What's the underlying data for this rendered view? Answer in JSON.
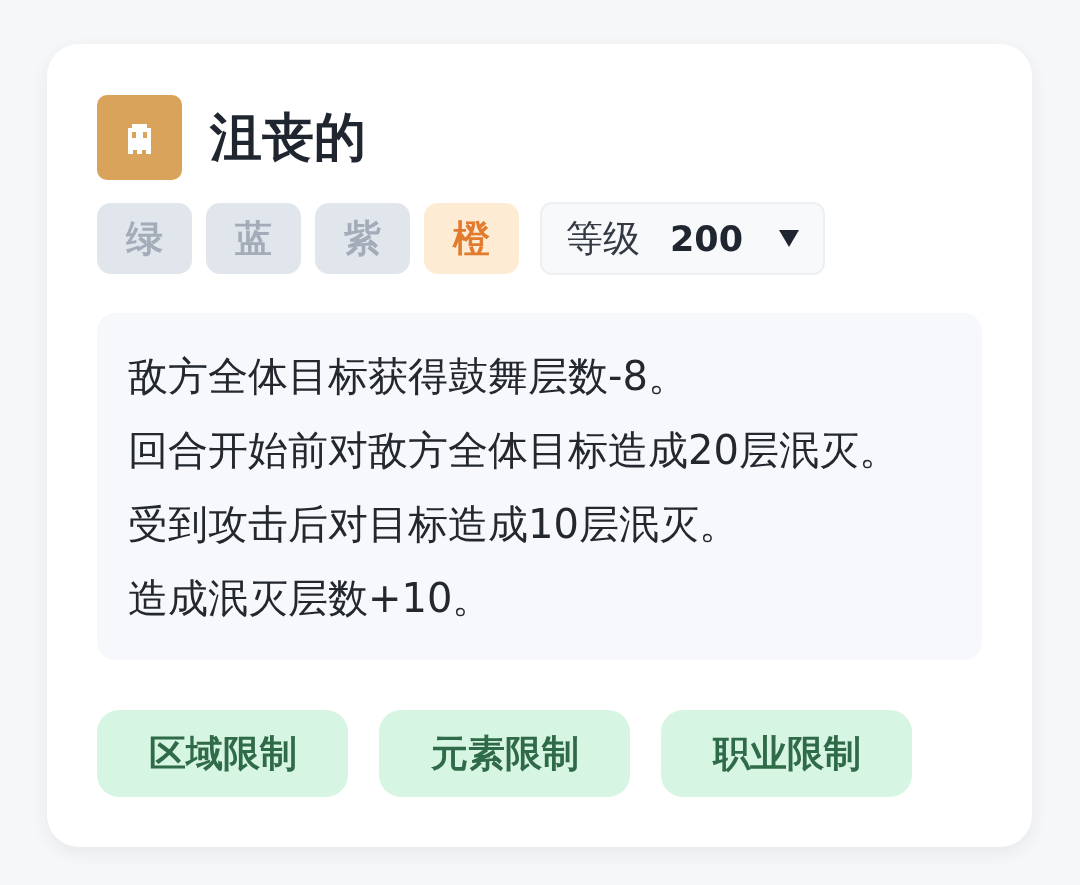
{
  "card": {
    "title": "沮丧的",
    "rarities": [
      {
        "label": "绿",
        "selected": false
      },
      {
        "label": "蓝",
        "selected": false
      },
      {
        "label": "紫",
        "selected": false
      },
      {
        "label": "橙",
        "selected": true
      }
    ],
    "level": {
      "label": "等级",
      "value": "200"
    },
    "description": [
      "敌方全体目标获得鼓舞层数-8。",
      "回合开始前对敌方全体目标造成20层泯灭。",
      "受到攻击后对目标造成10层泯灭。",
      "造成泯灭层数+10。"
    ],
    "restrictions": [
      "区域限制",
      "元素限制",
      "职业限制"
    ]
  }
}
